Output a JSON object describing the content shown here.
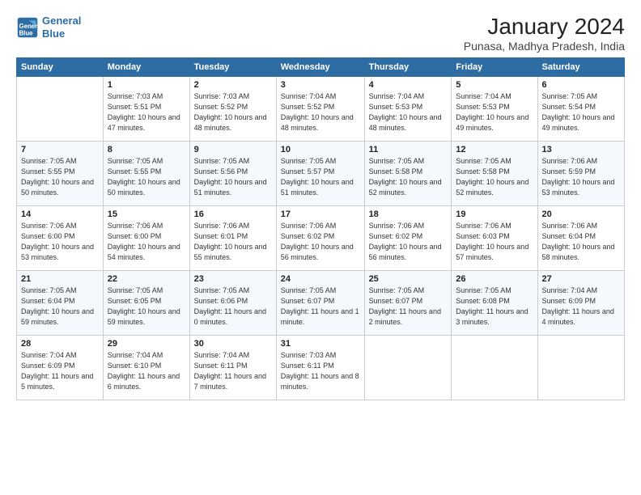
{
  "logo": {
    "line1": "General",
    "line2": "Blue"
  },
  "title": "January 2024",
  "subtitle": "Punasa, Madhya Pradesh, India",
  "days_of_week": [
    "Sunday",
    "Monday",
    "Tuesday",
    "Wednesday",
    "Thursday",
    "Friday",
    "Saturday"
  ],
  "weeks": [
    [
      {
        "day": "",
        "sunrise": "",
        "sunset": "",
        "daylight": ""
      },
      {
        "day": "1",
        "sunrise": "Sunrise: 7:03 AM",
        "sunset": "Sunset: 5:51 PM",
        "daylight": "Daylight: 10 hours and 47 minutes."
      },
      {
        "day": "2",
        "sunrise": "Sunrise: 7:03 AM",
        "sunset": "Sunset: 5:52 PM",
        "daylight": "Daylight: 10 hours and 48 minutes."
      },
      {
        "day": "3",
        "sunrise": "Sunrise: 7:04 AM",
        "sunset": "Sunset: 5:52 PM",
        "daylight": "Daylight: 10 hours and 48 minutes."
      },
      {
        "day": "4",
        "sunrise": "Sunrise: 7:04 AM",
        "sunset": "Sunset: 5:53 PM",
        "daylight": "Daylight: 10 hours and 48 minutes."
      },
      {
        "day": "5",
        "sunrise": "Sunrise: 7:04 AM",
        "sunset": "Sunset: 5:53 PM",
        "daylight": "Daylight: 10 hours and 49 minutes."
      },
      {
        "day": "6",
        "sunrise": "Sunrise: 7:05 AM",
        "sunset": "Sunset: 5:54 PM",
        "daylight": "Daylight: 10 hours and 49 minutes."
      }
    ],
    [
      {
        "day": "7",
        "sunrise": "Sunrise: 7:05 AM",
        "sunset": "Sunset: 5:55 PM",
        "daylight": "Daylight: 10 hours and 50 minutes."
      },
      {
        "day": "8",
        "sunrise": "Sunrise: 7:05 AM",
        "sunset": "Sunset: 5:55 PM",
        "daylight": "Daylight: 10 hours and 50 minutes."
      },
      {
        "day": "9",
        "sunrise": "Sunrise: 7:05 AM",
        "sunset": "Sunset: 5:56 PM",
        "daylight": "Daylight: 10 hours and 51 minutes."
      },
      {
        "day": "10",
        "sunrise": "Sunrise: 7:05 AM",
        "sunset": "Sunset: 5:57 PM",
        "daylight": "Daylight: 10 hours and 51 minutes."
      },
      {
        "day": "11",
        "sunrise": "Sunrise: 7:05 AM",
        "sunset": "Sunset: 5:58 PM",
        "daylight": "Daylight: 10 hours and 52 minutes."
      },
      {
        "day": "12",
        "sunrise": "Sunrise: 7:05 AM",
        "sunset": "Sunset: 5:58 PM",
        "daylight": "Daylight: 10 hours and 52 minutes."
      },
      {
        "day": "13",
        "sunrise": "Sunrise: 7:06 AM",
        "sunset": "Sunset: 5:59 PM",
        "daylight": "Daylight: 10 hours and 53 minutes."
      }
    ],
    [
      {
        "day": "14",
        "sunrise": "Sunrise: 7:06 AM",
        "sunset": "Sunset: 6:00 PM",
        "daylight": "Daylight: 10 hours and 53 minutes."
      },
      {
        "day": "15",
        "sunrise": "Sunrise: 7:06 AM",
        "sunset": "Sunset: 6:00 PM",
        "daylight": "Daylight: 10 hours and 54 minutes."
      },
      {
        "day": "16",
        "sunrise": "Sunrise: 7:06 AM",
        "sunset": "Sunset: 6:01 PM",
        "daylight": "Daylight: 10 hours and 55 minutes."
      },
      {
        "day": "17",
        "sunrise": "Sunrise: 7:06 AM",
        "sunset": "Sunset: 6:02 PM",
        "daylight": "Daylight: 10 hours and 56 minutes."
      },
      {
        "day": "18",
        "sunrise": "Sunrise: 7:06 AM",
        "sunset": "Sunset: 6:02 PM",
        "daylight": "Daylight: 10 hours and 56 minutes."
      },
      {
        "day": "19",
        "sunrise": "Sunrise: 7:06 AM",
        "sunset": "Sunset: 6:03 PM",
        "daylight": "Daylight: 10 hours and 57 minutes."
      },
      {
        "day": "20",
        "sunrise": "Sunrise: 7:06 AM",
        "sunset": "Sunset: 6:04 PM",
        "daylight": "Daylight: 10 hours and 58 minutes."
      }
    ],
    [
      {
        "day": "21",
        "sunrise": "Sunrise: 7:05 AM",
        "sunset": "Sunset: 6:04 PM",
        "daylight": "Daylight: 10 hours and 59 minutes."
      },
      {
        "day": "22",
        "sunrise": "Sunrise: 7:05 AM",
        "sunset": "Sunset: 6:05 PM",
        "daylight": "Daylight: 10 hours and 59 minutes."
      },
      {
        "day": "23",
        "sunrise": "Sunrise: 7:05 AM",
        "sunset": "Sunset: 6:06 PM",
        "daylight": "Daylight: 11 hours and 0 minutes."
      },
      {
        "day": "24",
        "sunrise": "Sunrise: 7:05 AM",
        "sunset": "Sunset: 6:07 PM",
        "daylight": "Daylight: 11 hours and 1 minute."
      },
      {
        "day": "25",
        "sunrise": "Sunrise: 7:05 AM",
        "sunset": "Sunset: 6:07 PM",
        "daylight": "Daylight: 11 hours and 2 minutes."
      },
      {
        "day": "26",
        "sunrise": "Sunrise: 7:05 AM",
        "sunset": "Sunset: 6:08 PM",
        "daylight": "Daylight: 11 hours and 3 minutes."
      },
      {
        "day": "27",
        "sunrise": "Sunrise: 7:04 AM",
        "sunset": "Sunset: 6:09 PM",
        "daylight": "Daylight: 11 hours and 4 minutes."
      }
    ],
    [
      {
        "day": "28",
        "sunrise": "Sunrise: 7:04 AM",
        "sunset": "Sunset: 6:09 PM",
        "daylight": "Daylight: 11 hours and 5 minutes."
      },
      {
        "day": "29",
        "sunrise": "Sunrise: 7:04 AM",
        "sunset": "Sunset: 6:10 PM",
        "daylight": "Daylight: 11 hours and 6 minutes."
      },
      {
        "day": "30",
        "sunrise": "Sunrise: 7:04 AM",
        "sunset": "Sunset: 6:11 PM",
        "daylight": "Daylight: 11 hours and 7 minutes."
      },
      {
        "day": "31",
        "sunrise": "Sunrise: 7:03 AM",
        "sunset": "Sunset: 6:11 PM",
        "daylight": "Daylight: 11 hours and 8 minutes."
      },
      {
        "day": "",
        "sunrise": "",
        "sunset": "",
        "daylight": ""
      },
      {
        "day": "",
        "sunrise": "",
        "sunset": "",
        "daylight": ""
      },
      {
        "day": "",
        "sunrise": "",
        "sunset": "",
        "daylight": ""
      }
    ]
  ]
}
